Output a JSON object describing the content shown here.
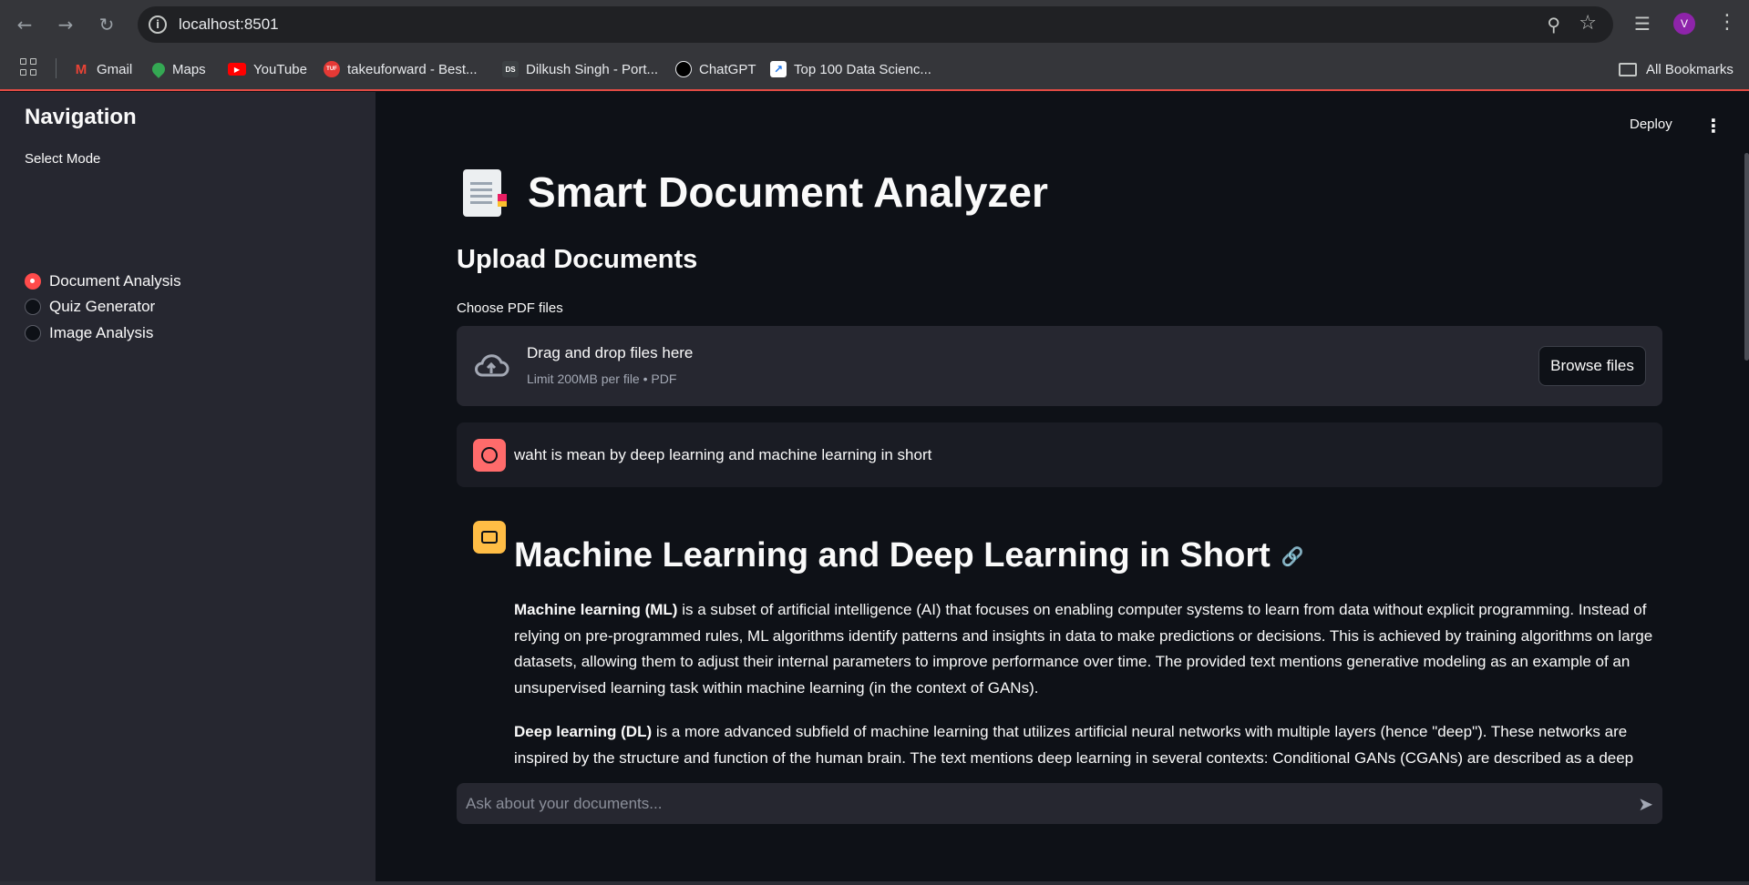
{
  "browser": {
    "url": "localhost:8501",
    "bookmarks": [
      {
        "label": "Gmail",
        "icon": "gmail-icon",
        "color": "#ea4335"
      },
      {
        "label": "Maps",
        "icon": "maps-icon",
        "color": "#34a853"
      },
      {
        "label": "YouTube",
        "icon": "youtube-icon",
        "color": "#ff0000"
      },
      {
        "label": "takeuforward - Best...",
        "icon": "takeuforward-icon",
        "color": "#e53935"
      },
      {
        "label": "Dilkush Singh - Port...",
        "icon": "portfolio-icon",
        "color": "#3c4043"
      },
      {
        "label": "ChatGPT",
        "icon": "chatgpt-icon",
        "color": "#000000"
      },
      {
        "label": "Top 100 Data Scienc...",
        "icon": "chart-icon",
        "color": "#ffffff"
      }
    ],
    "all_bookmarks_label": "All Bookmarks",
    "profile_initial": "V"
  },
  "sidebar": {
    "title": "Navigation",
    "select_label": "Select Mode",
    "modes": [
      {
        "label": "Document Analysis",
        "selected": true
      },
      {
        "label": "Quiz Generator",
        "selected": false
      },
      {
        "label": "Image Analysis",
        "selected": false
      }
    ]
  },
  "header": {
    "deploy_label": "Deploy"
  },
  "main": {
    "title": "Smart Document Analyzer",
    "upload_heading": "Upload Documents",
    "uploader_label": "Choose PDF files",
    "drop_text": "Drag and drop files here",
    "drop_limit": "Limit 200MB per file • PDF",
    "browse_label": "Browse files"
  },
  "chat": {
    "user_message": "waht is mean by deep learning and machine learning in short",
    "answer_heading": "Machine Learning and Deep Learning in Short",
    "paragraphs": [
      {
        "bold": "Machine learning (ML)",
        "text": " is a subset of artificial intelligence (AI) that focuses on enabling computer systems to learn from data without explicit programming. Instead of relying on pre-programmed rules, ML algorithms identify patterns and insights in data to make predictions or decisions. This is achieved by training algorithms on large datasets, allowing them to adjust their internal parameters to improve performance over time. The provided text mentions generative modeling as an example of an unsupervised learning task within machine learning (in the context of GANs)."
      },
      {
        "bold": "Deep learning (DL)",
        "text": " is a more advanced subfield of machine learning that utilizes artificial neural networks with multiple layers (hence \"deep\"). These networks are inspired by the structure and function of the human brain. The text mentions deep learning in several contexts: Conditional GANs (CGANs) are described as a deep"
      }
    ],
    "input_placeholder": "Ask about your documents..."
  },
  "colors": {
    "accent": "#ff4b4b",
    "background": "#0e1117",
    "sidebar": "#262730",
    "user_avatar": "#ff6b6b",
    "bot_avatar": "#ffbd45"
  }
}
